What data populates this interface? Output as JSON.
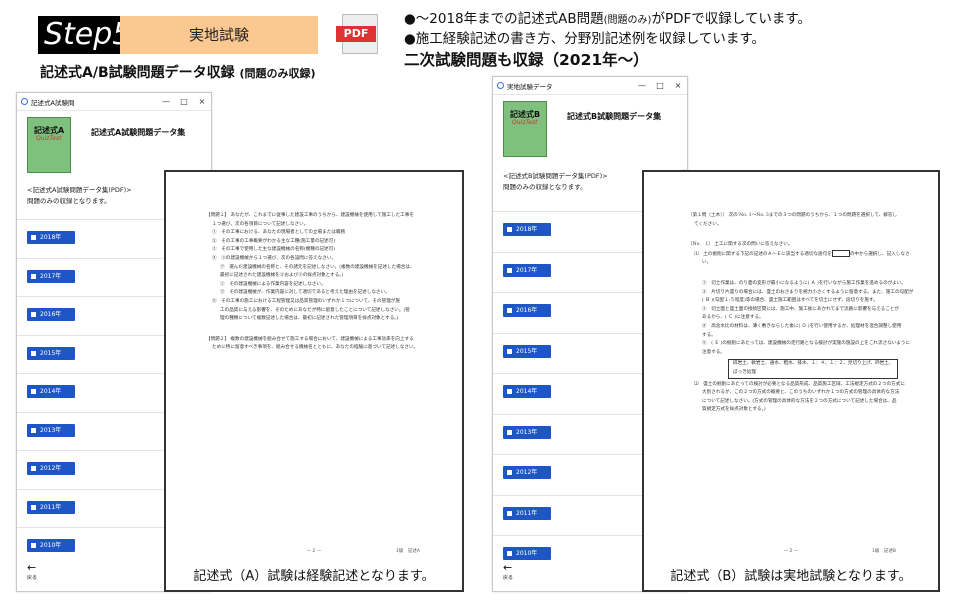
{
  "header": {
    "step": "Step5",
    "step_title": "実地試験",
    "subtitle": "記述式A/B試験問題データ収録",
    "subtitle_note": "(問題のみ収録)",
    "pdf_icon_label": "PDF"
  },
  "notes": {
    "line1_main": "●～2018年までの記述式AB問題",
    "line1_small": "(問題のみ)",
    "line1_end": "がPDFで収録しています。",
    "line2": "●施工経験記述の書き方、分野別記述例を収録しています。",
    "line3": "二次試験問題も収録（2021年～）"
  },
  "app_a": {
    "window_title": "記述式A試験問",
    "window_controls": [
      "—",
      "□",
      "×"
    ],
    "book_title": "記述式A",
    "book_sub": "QuizTest",
    "heading": "記述式A試験問題データ集",
    "section_title": "<記述式A試験問題データ集(PDF)>",
    "section_desc": "問題のみの収録となります。",
    "years": [
      "2018年",
      "2017年",
      "2016年",
      "2015年",
      "2014年",
      "2013年",
      "2012年",
      "2011年",
      "2010年"
    ],
    "back_arrow": "←",
    "back_label": "戻る"
  },
  "app_b": {
    "window_title": "実地試験データ",
    "window_controls": [
      "—",
      "□",
      "×"
    ],
    "book_title": "記述式B",
    "book_sub": "QuizTest",
    "heading": "記述式B試験問題データ集",
    "section_title": "<記述式B試験問題データ集(PDF)>",
    "section_desc": "問題のみの収録となります。",
    "years": [
      "2018年",
      "2017年",
      "2016年",
      "2015年",
      "2014年",
      "2013年",
      "2012年",
      "2011年",
      "2010年"
    ],
    "back_arrow": "←",
    "back_label": "戻る"
  },
  "doc_a": {
    "lines": [
      "【問題１】 あなたが、これまでに従事した建設工事のうちから、建設機械を使用して施工した工事を",
      "１つ選び、次の各項目について記述しなさい。",
      "①　その工事における、あなたの現場者としての立場または職務",
      "②　その工事の工事概要がわかる主な工種(施工量の記述可)",
      "③　その工事で使用した主な建設機械の名称(機種の記述可)",
      "④　③の建設機械から１つ選び、次の各設問に答えなさい。",
      "㋐　選んだ建設機械の名称と、その諸元を記述しなさい。(複数の建設機械を記述した場合は、",
      "最初に記述された建設機械を②および③の採点対象とする。)",
      "㋑　その建設機械による作業内容を記述しなさい。",
      "㋒　その建設機械が、作業内容に対して適切であると考えた理由を記述しなさい。",
      "⑤　その工事の施工における工程管理又は品質管理のいずれか１つについて、その管理が施",
      "工の品質に与える影響を、そのためにあなたが特に留意したことについて記述しなさい。(管",
      "理の種類について複数記述した場合は、最初に記述された管理項目を採点対象とする。)",
      "【問題２】 複数の建設機械を組み合せて施工する場合において、建設機械による工事効率を向上する",
      "ために特に留意すべき事項を、組み合せる機械名とともに、あなたの経験に基づいて記述しなさい。"
    ],
    "page_no": "— 2 —",
    "page_side": "1級　記述A",
    "caption": "記述式（A）試験は経験記述となります。"
  },
  "doc_b": {
    "intro1": "〔第１問（土木）〕 次の No. 1〜No. 3までの３つの問題のうちから、１つの問題を選択して、解答し",
    "intro2": "てください。",
    "q_title": "〔No.　1〕 土工に関する次の問いに答えなさい。",
    "q_sub1a": "⑴　土の掘削に関する下記の記述のＡ〜Ｅに該当する適切な語句を",
    "q_sub1b": "の中から選択し、記入しなさ",
    "q_sub1c": "い。",
    "items": [
      "①　切土作業は、のり面の変形が最小になるように( Ａ )を行いながら施工作業を進めるのがよい。",
      "②　片切り片盛りの場合には、盛土のおさまりを極力小さくするように留意する。また、施工の勾配が",
      "( Ｂ )(勾配１:５程度)等の場合、盛土施工範囲はすべてを切土にせず、段切りを施す。",
      "③　切土面と盛土面の接続区間には、施工中、施工後にあかれてまで流路に影響を与えることが",
      "あるから、( Ｃ )に注意する。",
      "④　高含水比の材料は、薄く敷きならした後に( Ｄ )を行い使用するか、処理材を混合調整し使用",
      "する。",
      "⑤　( Ｅ )の掘削にあたっては、建設機械の走行路となる検討が実施の施設の上をこれ流さないように",
      "注意する。"
    ],
    "terms1": "碎岩土、軟岩土、通水、粗水、排水、１：４、１：２、見切り上げ、砕岩土、",
    "terms2": "ぼっき処理",
    "q2a": "⑵　盛土の掘削にあたっての検討が必要となる品質形成、品質施工区域、工法規定方式の２つの方式に",
    "q2b": "大別されるが、この２つの方式の概要と、このうちのいずれか１つの方式の管理の具体的な方法",
    "q2c": "について記述しなさい。(方式の管理の具体的な方法を２つの方式について記述した場合は、品",
    "q2d": "質規定方式を採点対象とする。)",
    "page_no": "— 2 —",
    "page_side": "1級　記述B",
    "caption": "記述式（B）試験は実地試験となります。"
  },
  "colors": {
    "step_bg": "#000000",
    "step_title_bg": "#fac890",
    "year_button": "#1f56c6",
    "pdf_red": "#dd3333",
    "book_green": "#7fc07f"
  }
}
